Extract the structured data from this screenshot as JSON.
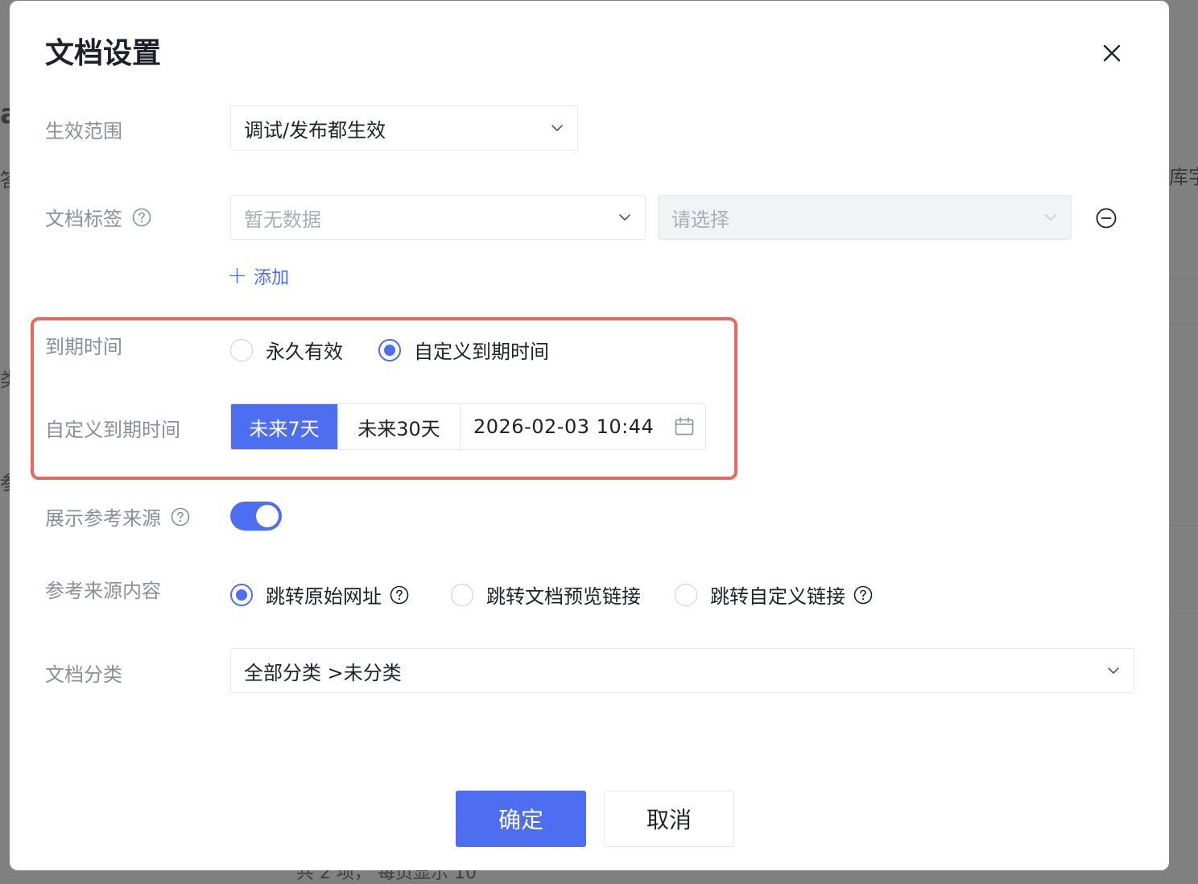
{
  "dialog": {
    "title": "文档设置",
    "close_icon": "close-icon"
  },
  "form": {
    "scope": {
      "label": "生效范围",
      "value": "调试/发布都生效"
    },
    "tags": {
      "label": "文档标签",
      "tag_placeholder": "暂无数据",
      "value_placeholder": "请选择",
      "add_label": "添加"
    },
    "expiry": {
      "label": "到期时间",
      "options": [
        "永久有效",
        "自定义到期时间"
      ],
      "selected": "自定义到期时间"
    },
    "custom_expiry": {
      "label": "自定义到期时间",
      "presets": [
        "未来7天",
        "未来30天"
      ],
      "active_preset": "未来7天",
      "datetime": "2026-02-03 10:44"
    },
    "show_reference": {
      "label": "展示参考来源",
      "enabled": true
    },
    "reference_content": {
      "label": "参考来源内容",
      "options": [
        "跳转原始网址",
        "跳转文档预览链接",
        "跳转自定义链接"
      ],
      "selected": "跳转原始网址"
    },
    "category": {
      "label": "文档分类",
      "value": "全部分类 >未分类"
    }
  },
  "footer": {
    "confirm": "确定",
    "cancel": "取消"
  },
  "background": {
    "fragments": [
      "a",
      "答",
      "类",
      "参",
      "库字"
    ],
    "pagination": "共 2 项， 每页显示 10"
  },
  "colors": {
    "primary": "#4e6ef2",
    "highlight_border": "#e8685c"
  }
}
